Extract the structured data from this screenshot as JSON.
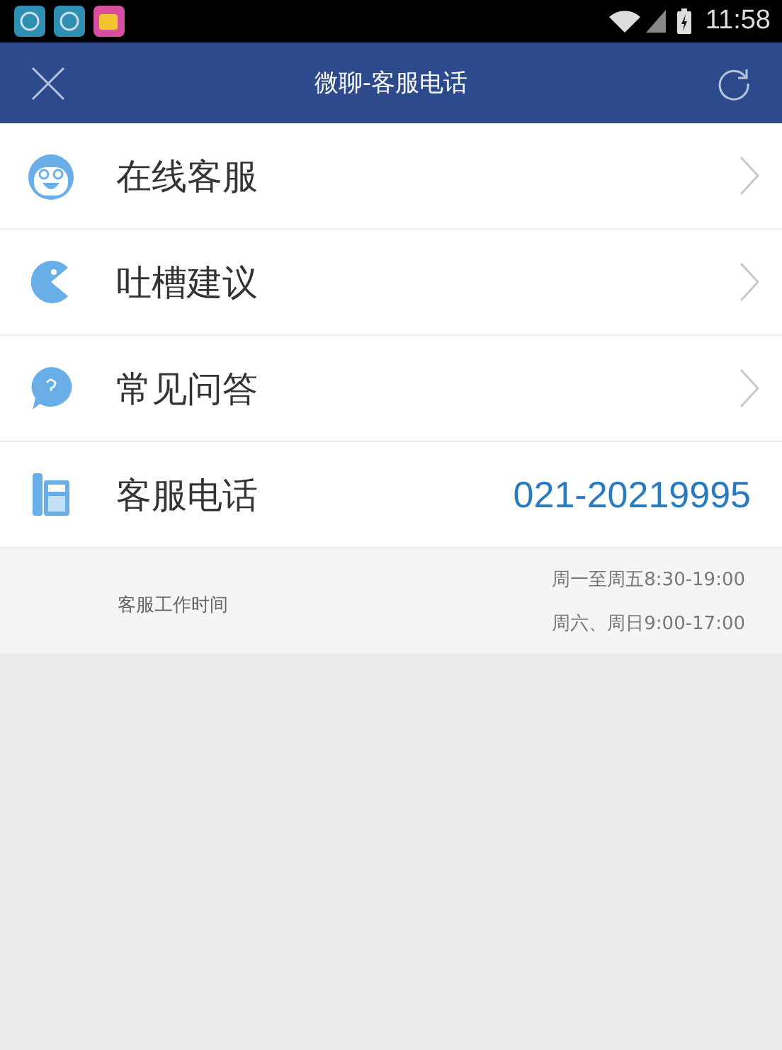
{
  "status_bar": {
    "time": "11:58"
  },
  "header": {
    "title": "微聊-客服电话"
  },
  "menu": [
    {
      "kind": "link",
      "label": "在线客服"
    },
    {
      "kind": "link",
      "label": "吐槽建议"
    },
    {
      "kind": "link",
      "label": "常见问答"
    },
    {
      "kind": "phone",
      "label": "客服电话",
      "value": "021-20219995"
    }
  ],
  "hours": {
    "label": "客服工作时间",
    "lines": [
      "周一至周五8:30-19:00",
      "周六、周日9:00-17:00"
    ]
  }
}
